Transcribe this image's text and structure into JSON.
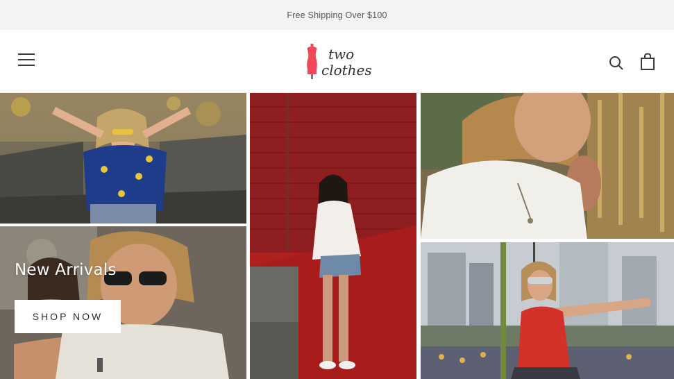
{
  "announcement": {
    "text": "Free Shipping Over $100"
  },
  "header": {
    "logo": {
      "line1": "two",
      "line2": "clothes",
      "accent_color": "#f0475a"
    },
    "menu_icon": "hamburger-icon",
    "search_icon": "search-icon",
    "cart_icon": "shopping-bag-icon"
  },
  "hero": {
    "title": "New Arrivals",
    "cta_label": "SHOP NOW"
  },
  "gallery": {
    "images": [
      {
        "name": "model-yellow-sunglasses"
      },
      {
        "name": "couple-piggyback"
      },
      {
        "name": "model-red-brick-wall"
      },
      {
        "name": "man-white-shirt"
      },
      {
        "name": "woman-pointing-amusement-park"
      }
    ]
  }
}
